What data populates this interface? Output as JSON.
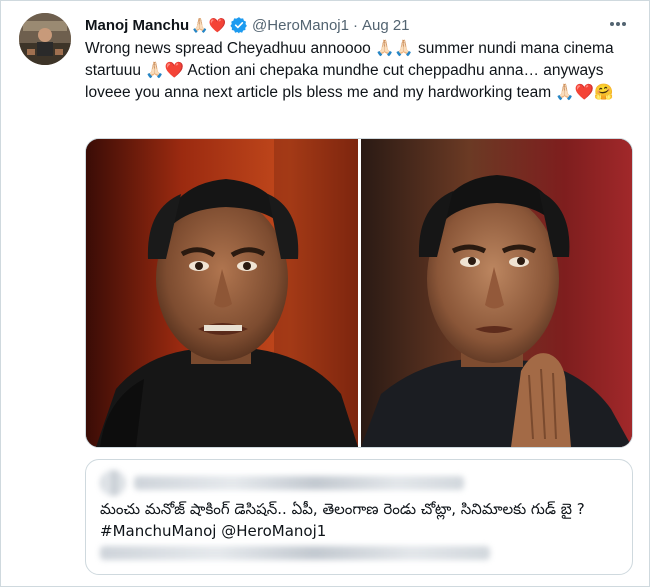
{
  "tweet": {
    "author_name": "Manoj Manchu",
    "name_emojis": "🙏🏻❤️",
    "handle": "@HeroManoj1",
    "separator": "·",
    "date": "Aug 21",
    "text": "Wrong news spread Cheyadhuu annoooo 🙏🏻🙏🏻 summer nundi mana cinema startuuu 🙏🏻❤️ Action ani chepaka mundhe cut cheppadhu anna… anyways loveee you anna next article pls bless me and my hardworking team 🙏🏻❤️🤗"
  },
  "quoted_tweet": {
    "text_line_1": "మంచు మనోజ్ షాకింగ్ డెసిషన్.. ఏపీ, తెలంగాణ రెండు చోట్లా, సినిమాలకు గుడ్ బై ?",
    "text_line_2": "#ManchuManoj @HeroManoj1"
  },
  "colors": {
    "text": "#0f1419",
    "secondary": "#536471",
    "verified": "#1d9bf0",
    "heart": "#f91880",
    "border": "#cfd9de"
  },
  "icons": {
    "verified": "verified-badge-icon",
    "more": "more-horizontal-icon"
  }
}
